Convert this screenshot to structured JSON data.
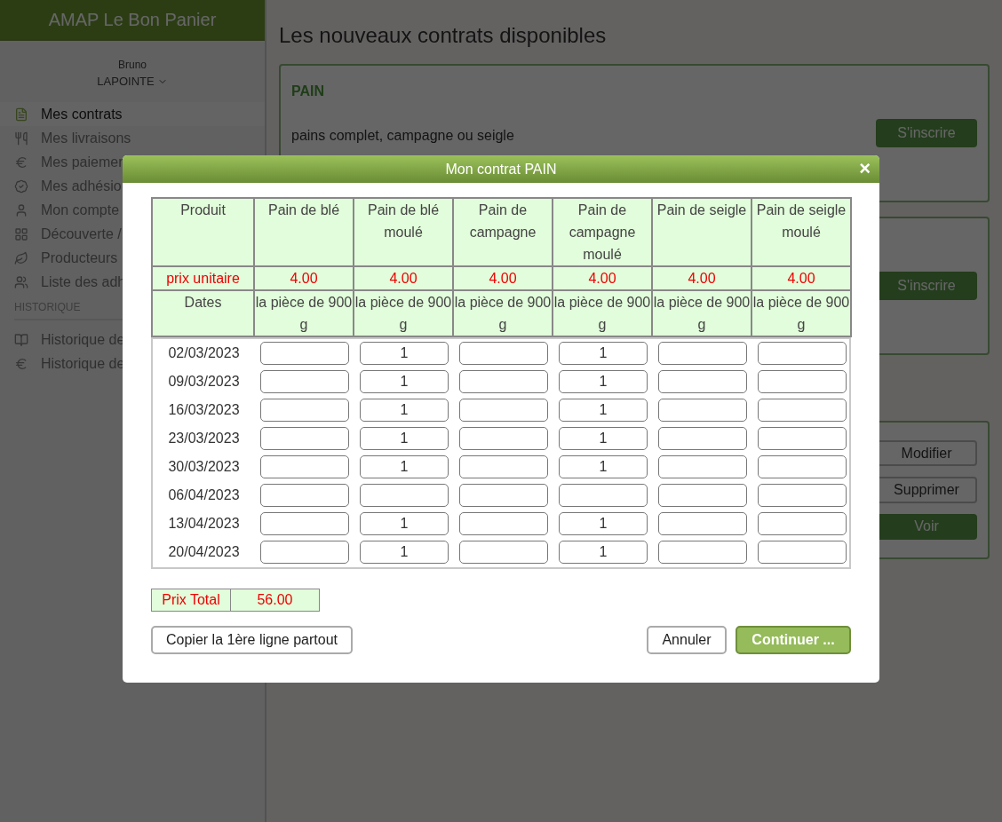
{
  "sidebar": {
    "title": "AMAP Le Bon Panier",
    "user": {
      "first_name": "Bruno",
      "last_name": "LAPOINTE"
    },
    "items": [
      {
        "label": "Mes contrats",
        "selected": true
      },
      {
        "label": "Mes livraisons",
        "selected": false
      },
      {
        "label": "Mes paiemen",
        "selected": false
      },
      {
        "label": "Mes adhésio",
        "selected": false
      },
      {
        "label": "Mon compte",
        "selected": false
      },
      {
        "label": "Découverte /",
        "selected": false
      },
      {
        "label": "Producteurs",
        "selected": false
      },
      {
        "label": "Liste des adh",
        "selected": false
      }
    ],
    "section": "HISTORIQUE",
    "history_items": [
      {
        "label": "Historique de",
        "selected": false
      },
      {
        "label": "Historique de",
        "selected": false
      }
    ]
  },
  "main": {
    "heading": "Les nouveaux contrats disponibles",
    "cards": [
      {
        "title": "PAIN",
        "description": "pains complet, campagne ou seigle",
        "buttons": [
          {
            "label": "S'inscrire",
            "kind": "primary"
          }
        ]
      },
      {
        "buttons": [
          {
            "label": "S'inscrire",
            "kind": "primary"
          }
        ]
      },
      {
        "buttons": [
          {
            "label": "Modifier",
            "kind": "outline"
          },
          {
            "label": "Supprimer",
            "kind": "outline"
          },
          {
            "label": "Voir",
            "kind": "primary"
          }
        ]
      }
    ]
  },
  "modal": {
    "title": "Mon contrat PAIN",
    "close": "×",
    "product_label": "Produit",
    "price_label": "prix unitaire",
    "dates_label": "Dates",
    "products": [
      {
        "name": "Pain de blé",
        "price": "4.00",
        "unit": "la pièce de 900 g"
      },
      {
        "name": "Pain de blé moulé",
        "price": "4.00",
        "unit": "la pièce de 900 g"
      },
      {
        "name": "Pain de campagne",
        "price": "4.00",
        "unit": "la pièce de 900 g"
      },
      {
        "name": "Pain de campagne moulé",
        "price": "4.00",
        "unit": "la pièce de 900 g"
      },
      {
        "name": "Pain de seigle",
        "price": "4.00",
        "unit": "la pièce de 900 g"
      },
      {
        "name": "Pain de seigle moulé",
        "price": "4.00",
        "unit": "la pièce de 900 g"
      }
    ],
    "rows": [
      {
        "date": "02/03/2023",
        "quantities": [
          {
            "kind": "blank"
          },
          {
            "kind": "entry",
            "value": "1"
          },
          {
            "kind": "blank"
          },
          {
            "kind": "entry",
            "value": "1"
          },
          {
            "kind": "blank"
          },
          {
            "kind": "blank"
          }
        ]
      },
      {
        "date": "09/03/2023",
        "quantities": [
          {
            "kind": "blank"
          },
          {
            "kind": "entry",
            "value": "1"
          },
          {
            "kind": "blank"
          },
          {
            "kind": "entry",
            "value": "1"
          },
          {
            "kind": "blank"
          },
          {
            "kind": "blank"
          }
        ]
      },
      {
        "date": "16/03/2023",
        "quantities": [
          {
            "kind": "blank"
          },
          {
            "kind": "entry",
            "value": "1"
          },
          {
            "kind": "blank"
          },
          {
            "kind": "entry",
            "value": "1"
          },
          {
            "kind": "blank"
          },
          {
            "kind": "blank"
          }
        ]
      },
      {
        "date": "23/03/2023",
        "quantities": [
          {
            "kind": "blank"
          },
          {
            "kind": "entry",
            "value": "1"
          },
          {
            "kind": "blank"
          },
          {
            "kind": "entry",
            "value": "1"
          },
          {
            "kind": "blank"
          },
          {
            "kind": "blank"
          }
        ]
      },
      {
        "date": "30/03/2023",
        "quantities": [
          {
            "kind": "blank"
          },
          {
            "kind": "entry",
            "value": "1"
          },
          {
            "kind": "blank"
          },
          {
            "kind": "entry",
            "value": "1"
          },
          {
            "kind": "blank"
          },
          {
            "kind": "blank"
          }
        ]
      },
      {
        "date": "06/04/2023",
        "quantities": [
          {
            "kind": "blank"
          },
          {
            "kind": "blank"
          },
          {
            "kind": "blank"
          },
          {
            "kind": "blank"
          },
          {
            "kind": "blank"
          },
          {
            "kind": "blank"
          }
        ]
      },
      {
        "date": "13/04/2023",
        "quantities": [
          {
            "kind": "blank"
          },
          {
            "kind": "entry",
            "value": "1"
          },
          {
            "kind": "blank"
          },
          {
            "kind": "entry",
            "value": "1"
          },
          {
            "kind": "blank"
          },
          {
            "kind": "blank"
          }
        ]
      },
      {
        "date": "20/04/2023",
        "quantities": [
          {
            "kind": "blank"
          },
          {
            "kind": "entry",
            "value": "1"
          },
          {
            "kind": "blank"
          },
          {
            "kind": "entry",
            "value": "1"
          },
          {
            "kind": "blank"
          },
          {
            "kind": "blank"
          }
        ]
      }
    ],
    "total_label": "Prix Total",
    "total": "56.00",
    "buttons": [
      {
        "label": "Copier la 1ère ligne partout",
        "kind": "outline"
      },
      {
        "label": "Annuler",
        "kind": "outline"
      },
      {
        "label": "Continuer ...",
        "kind": "primary"
      }
    ]
  }
}
